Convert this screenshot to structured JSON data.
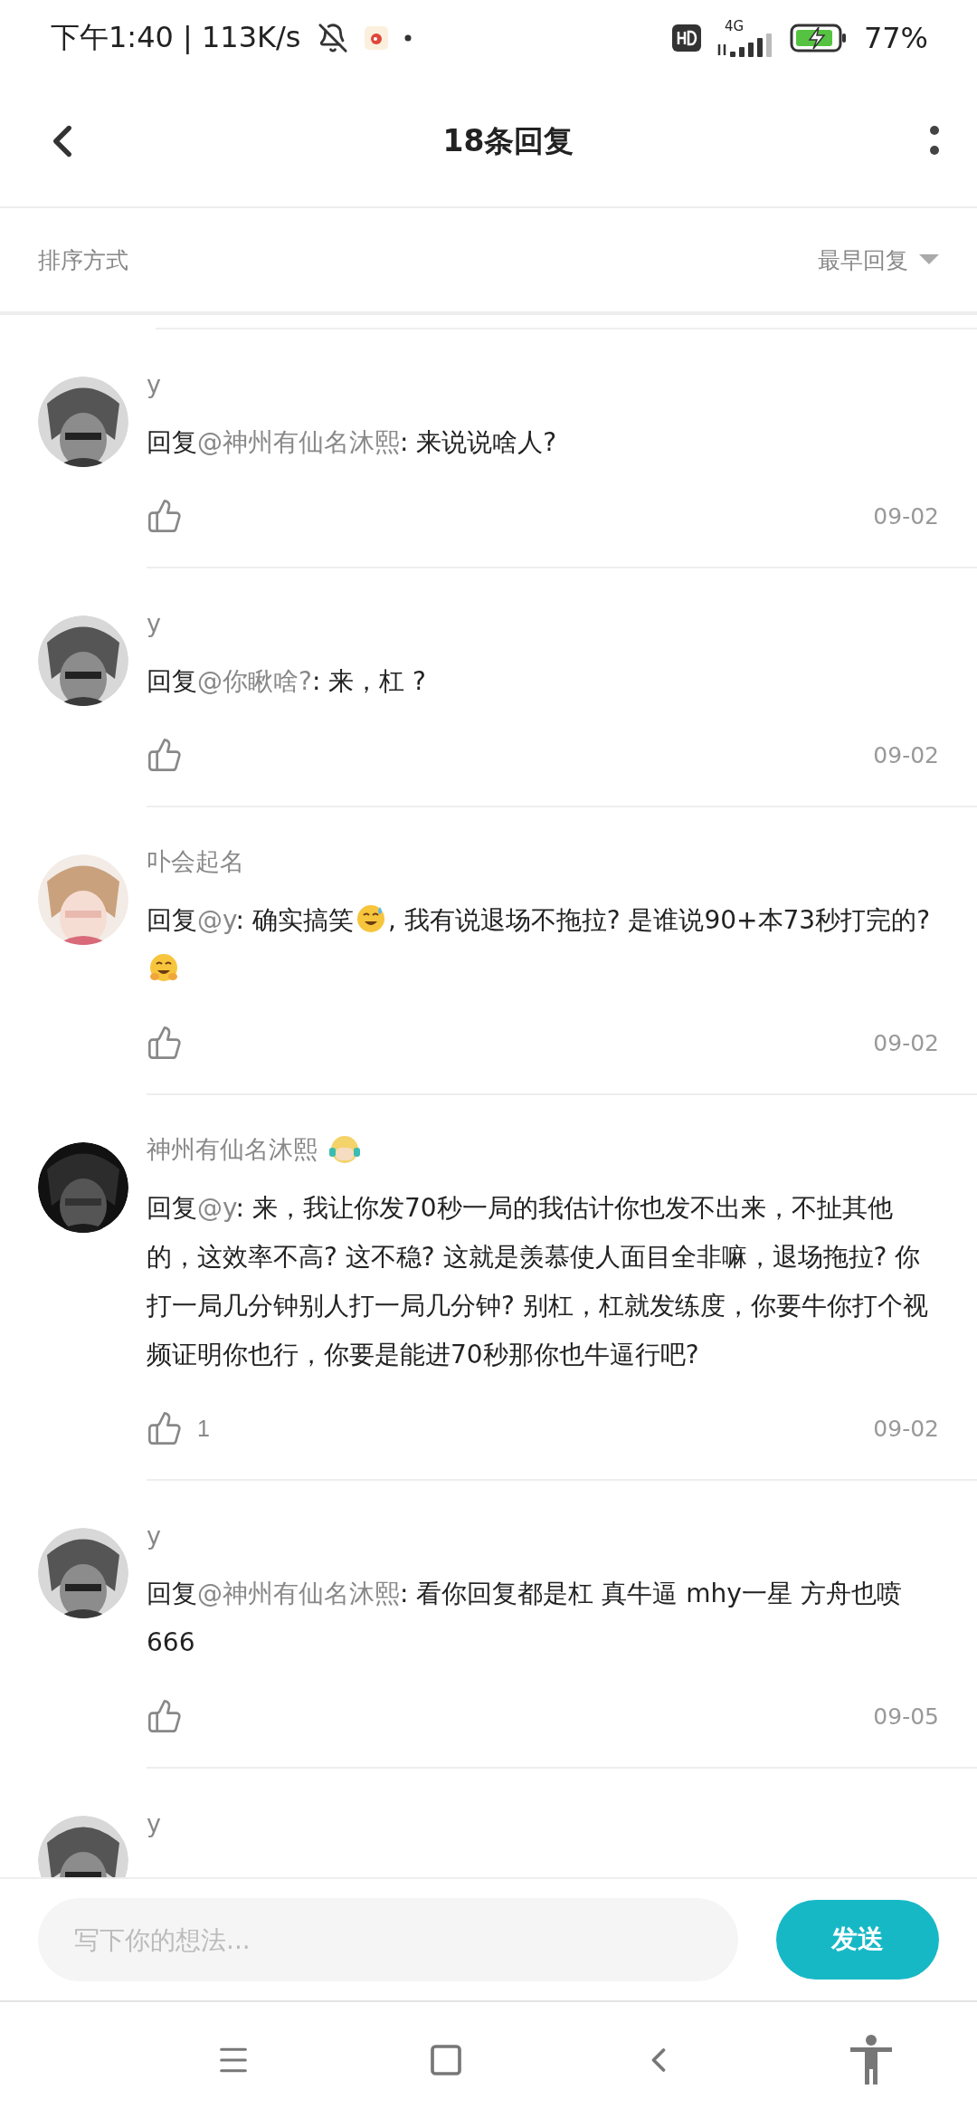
{
  "status_bar": {
    "time": "下午1:40 | 113K/s",
    "network": "4G",
    "battery": "77%"
  },
  "header": {
    "title": "18条回复"
  },
  "sort": {
    "label": "排序方式",
    "value": "最早回复"
  },
  "comments": [
    {
      "author": "y",
      "badge": false,
      "body": [
        {
          "kind": "text",
          "text": "回复"
        },
        {
          "kind": "mention",
          "text": "@神州有仙名沐熙"
        },
        {
          "kind": "text",
          "text": ": 来说说啥人?"
        }
      ],
      "date": "09-02"
    },
    {
      "author": "y",
      "badge": false,
      "body": [
        {
          "kind": "text",
          "text": "回复"
        },
        {
          "kind": "mention",
          "text": "@你瞅啥?"
        },
        {
          "kind": "text",
          "text": ": 来，杠 ?"
        }
      ],
      "date": "09-02"
    },
    {
      "author": "卟会起名",
      "badge": false,
      "body": [
        {
          "kind": "text",
          "text": "回复"
        },
        {
          "kind": "mention",
          "text": "@y"
        },
        {
          "kind": "text",
          "text": ": 确实搞笑"
        },
        {
          "kind": "sweat"
        },
        {
          "kind": "text",
          "text": ", 我有说退场不拖拉? 是谁说90+本73秒打完的?"
        },
        {
          "kind": "hug"
        }
      ],
      "date": "09-02"
    },
    {
      "author": "神州有仙名沐熙",
      "badge": true,
      "body": [
        {
          "kind": "text",
          "text": "回复"
        },
        {
          "kind": "mention",
          "text": "@y"
        },
        {
          "kind": "text",
          "text": ": 来，我让你发70秒一局的我估计你也发不出来，不扯其他的，这效率不高? 这不稳? 这就是羡慕使人面目全非嘛，退场拖拉? 你打一局几分钟别人打一局几分钟? 别杠，杠就发练度，你要牛你打个视频证明你也行，你要是能进70秒那你也牛逼行吧?"
        }
      ],
      "likes": "1",
      "date": "09-02"
    },
    {
      "author": "y",
      "badge": false,
      "body": [
        {
          "kind": "text",
          "text": "回复"
        },
        {
          "kind": "mention",
          "text": "@神州有仙名沐熙"
        },
        {
          "kind": "text",
          "text": ": 看你回复都是杠  真牛逼 mhy一星  方舟也喷 666"
        }
      ],
      "date": "09-05"
    },
    {
      "author": "y",
      "badge": false
    }
  ],
  "composer": {
    "placeholder": "写下你的想法...",
    "send": "发送"
  }
}
